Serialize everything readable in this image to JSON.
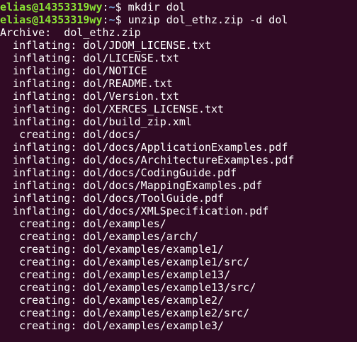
{
  "prompt": {
    "user_host": "elias@14353319wy",
    "sep": ":",
    "path": "~",
    "symbol": "$ "
  },
  "commands": [
    "mkdir dol",
    "unzip dol_ethz.zip -d dol"
  ],
  "output": [
    "Archive:  dol_ethz.zip",
    "  inflating: dol/JDOM_LICENSE.txt",
    "  inflating: dol/LICENSE.txt",
    "  inflating: dol/NOTICE",
    "  inflating: dol/README.txt",
    "  inflating: dol/Version.txt",
    "  inflating: dol/XERCES_LICENSE.txt",
    "  inflating: dol/build_zip.xml",
    "   creating: dol/docs/",
    "  inflating: dol/docs/ApplicationExamples.pdf",
    "  inflating: dol/docs/ArchitectureExamples.pdf",
    "  inflating: dol/docs/CodingGuide.pdf",
    "  inflating: dol/docs/MappingExamples.pdf",
    "  inflating: dol/docs/ToolGuide.pdf",
    "  inflating: dol/docs/XMLSpecification.pdf",
    "   creating: dol/examples/",
    "   creating: dol/examples/arch/",
    "   creating: dol/examples/example1/",
    "   creating: dol/examples/example1/src/",
    "   creating: dol/examples/example13/",
    "   creating: dol/examples/example13/src/",
    "   creating: dol/examples/example2/",
    "   creating: dol/examples/example2/src/",
    "   creating: dol/examples/example3/"
  ],
  "colors": {
    "background": "#300a24",
    "user_host": "#8ae234",
    "path": "#729fcf",
    "text": "#ffffff"
  }
}
